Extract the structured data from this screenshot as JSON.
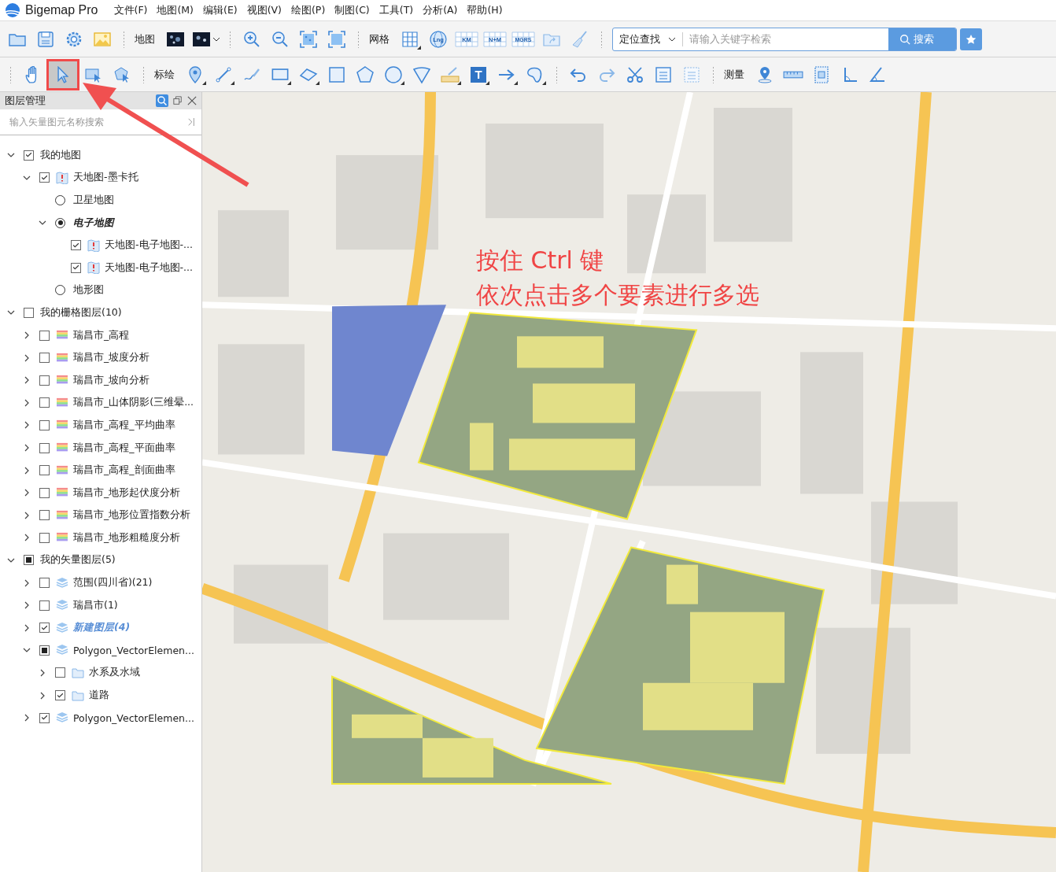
{
  "app": {
    "title": "Bigemap Pro"
  },
  "menu": [
    "文件(F)",
    "地图(M)",
    "编辑(E)",
    "视图(V)",
    "绘图(P)",
    "制图(C)",
    "工具(T)",
    "分析(A)",
    "帮助(H)"
  ],
  "toolbar_main": [
    {
      "kind": "folder"
    },
    {
      "kind": "save"
    },
    {
      "kind": "gear"
    },
    {
      "kind": "image"
    },
    {
      "kind": "sep"
    },
    {
      "kind": "label",
      "text": "地图"
    },
    {
      "kind": "satellite"
    },
    {
      "kind": "satellite-menu"
    },
    {
      "kind": "sep"
    },
    {
      "kind": "zoom-in"
    },
    {
      "kind": "zoom-out"
    },
    {
      "kind": "fit"
    },
    {
      "kind": "fullscreen"
    },
    {
      "kind": "sep"
    },
    {
      "kind": "label",
      "text": "网格"
    },
    {
      "kind": "grid"
    },
    {
      "kind": "globe",
      "text": "Lng"
    },
    {
      "kind": "grid-text",
      "text": "KM"
    },
    {
      "kind": "grid-text",
      "text": "N+M"
    },
    {
      "kind": "grid-text",
      "text": "MGRS"
    },
    {
      "kind": "folder-arrow"
    },
    {
      "kind": "broom"
    },
    {
      "kind": "sep"
    }
  ],
  "location_search": {
    "mode": "定位查找",
    "placeholder": "请输入关键字检索",
    "button": "搜索"
  },
  "toolbar_draw": [
    {
      "kind": "sep"
    },
    {
      "kind": "hand",
      "selected": false
    },
    {
      "kind": "pointer",
      "selected": true
    },
    {
      "kind": "rect-select",
      "selected": false
    },
    {
      "kind": "poly-select",
      "selected": false
    },
    {
      "kind": "sep"
    },
    {
      "kind": "label",
      "text": "标绘"
    },
    {
      "kind": "pin"
    },
    {
      "kind": "line"
    },
    {
      "kind": "pencil"
    },
    {
      "kind": "rectangle"
    },
    {
      "kind": "freeform"
    },
    {
      "kind": "square"
    },
    {
      "kind": "pentagon"
    },
    {
      "kind": "circle"
    },
    {
      "kind": "sector"
    },
    {
      "kind": "ruler-pencil"
    },
    {
      "kind": "text-tool",
      "text": "T"
    },
    {
      "kind": "arrow"
    },
    {
      "kind": "blob"
    },
    {
      "kind": "sep"
    },
    {
      "kind": "undo"
    },
    {
      "kind": "redo"
    },
    {
      "kind": "scissors"
    },
    {
      "kind": "doc"
    },
    {
      "kind": "doc-dotted"
    },
    {
      "kind": "sep"
    },
    {
      "kind": "label",
      "text": "测量"
    },
    {
      "kind": "location"
    },
    {
      "kind": "ruler"
    },
    {
      "kind": "area"
    },
    {
      "kind": "angle"
    },
    {
      "kind": "protractor"
    }
  ],
  "layer_panel": {
    "title": "图层管理",
    "search_placeholder": "输入矢量图元名称搜索",
    "layers": [
      {
        "label": "我的地图",
        "kind": "group",
        "checked": true,
        "expanded": true,
        "children": [
          {
            "label": "天地图-墨卡托",
            "kind": "map",
            "checked": true,
            "expanded": true,
            "children": [
              {
                "label": "卫星地图",
                "kind": "option",
                "selected": false
              },
              {
                "label": "电子地图",
                "kind": "option",
                "selected": true,
                "expanded": true,
                "children": [
                  {
                    "label": "天地图-电子地图-...",
                    "kind": "map",
                    "checked": true
                  },
                  {
                    "label": "天地图-电子地图-...",
                    "kind": "map",
                    "checked": true
                  }
                ]
              },
              {
                "label": "地形图",
                "kind": "option",
                "selected": false
              }
            ]
          }
        ]
      },
      {
        "label": "我的栅格图层(10)",
        "kind": "group",
        "checked": false,
        "expanded": true,
        "children": [
          {
            "label": "瑞昌市_高程",
            "kind": "raster",
            "checked": false,
            "expanded": false
          },
          {
            "label": "瑞昌市_坡度分析",
            "kind": "raster",
            "checked": false,
            "expanded": false
          },
          {
            "label": "瑞昌市_坡向分析",
            "kind": "raster",
            "checked": false,
            "expanded": false
          },
          {
            "label": "瑞昌市_山体阴影(三维晕...",
            "kind": "raster",
            "checked": false,
            "expanded": false
          },
          {
            "label": "瑞昌市_高程_平均曲率",
            "kind": "raster",
            "checked": false,
            "expanded": false
          },
          {
            "label": "瑞昌市_高程_平面曲率",
            "kind": "raster",
            "checked": false,
            "expanded": false
          },
          {
            "label": "瑞昌市_高程_剖面曲率",
            "kind": "raster",
            "checked": false,
            "expanded": false
          },
          {
            "label": "瑞昌市_地形起伏度分析",
            "kind": "raster",
            "checked": false,
            "expanded": false
          },
          {
            "label": "瑞昌市_地形位置指数分析",
            "kind": "raster",
            "checked": false,
            "expanded": false
          },
          {
            "label": "瑞昌市_地形粗糙度分析",
            "kind": "raster",
            "checked": false,
            "expanded": false
          }
        ]
      },
      {
        "label": "我的矢量图层(5)",
        "kind": "group",
        "checked": false,
        "partial": true,
        "expanded": true,
        "children": [
          {
            "label": "范围(四川省)(21)",
            "kind": "vector",
            "checked": false,
            "expanded": false
          },
          {
            "label": "瑞昌市(1)",
            "kind": "vector",
            "checked": false,
            "expanded": false
          },
          {
            "label": "新建图层(4)",
            "kind": "vector",
            "checked": true,
            "expanded": false,
            "active": true
          },
          {
            "label": "Polygon_VectorElemen...",
            "kind": "vector",
            "checked": false,
            "partial": true,
            "expanded": true,
            "children": [
              {
                "label": "水系及水域",
                "kind": "folder",
                "checked": false,
                "expanded": false
              },
              {
                "label": "道路",
                "kind": "folder",
                "checked": true,
                "expanded": false
              }
            ]
          },
          {
            "label": "Polygon_VectorElemen...",
            "kind": "vector",
            "checked": true,
            "expanded": false
          }
        ]
      }
    ]
  },
  "map": {
    "annotation": [
      "按住 Ctrl 键",
      "依次点击多个要素进行多选"
    ]
  }
}
